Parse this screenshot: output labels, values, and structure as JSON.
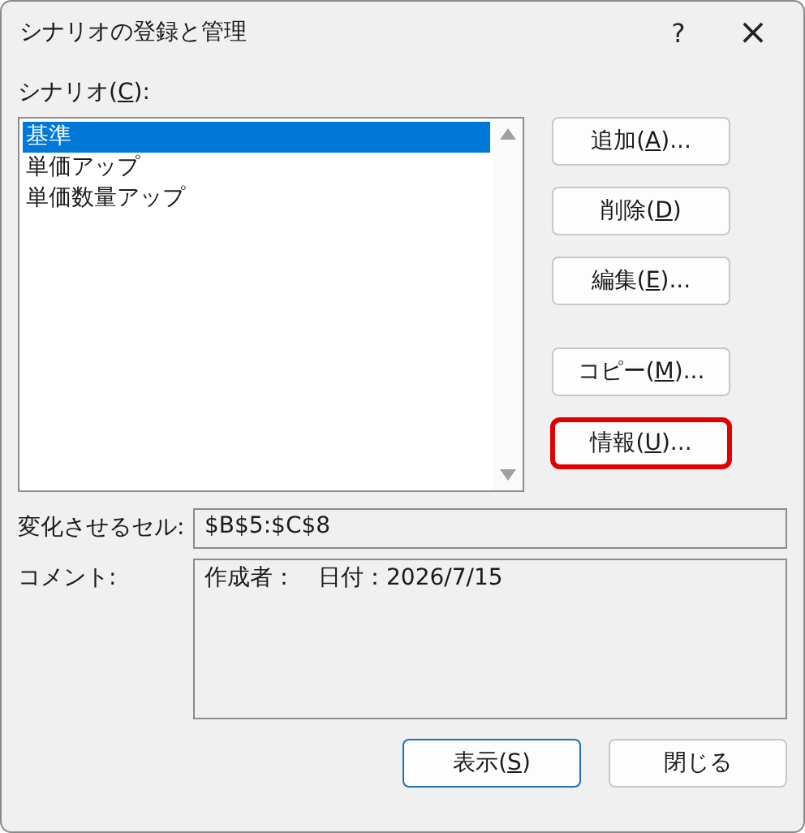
{
  "window": {
    "title": "シナリオの登録と管理",
    "help": "?",
    "close": "×"
  },
  "scenario_list": {
    "label_before": "シナリオ(",
    "access_key": "C",
    "label_after": "):",
    "items": [
      {
        "label": "基準",
        "selected": true
      },
      {
        "label": "単価アップ",
        "selected": false
      },
      {
        "label": "単価数量アップ",
        "selected": false
      }
    ]
  },
  "side_button_groups": [
    {
      "buttons": [
        {
          "label_before": "追加(",
          "access_key": "A",
          "label_after": ")...",
          "highlighted": false
        },
        {
          "label_before": "削除(",
          "access_key": "D",
          "label_after": ")",
          "highlighted": false
        },
        {
          "label_before": "編集(",
          "access_key": "E",
          "label_after": ")...",
          "highlighted": false
        }
      ]
    },
    {
      "buttons": [
        {
          "label_before": "コピー(",
          "access_key": "M",
          "label_after": ")...",
          "highlighted": false
        },
        {
          "label_before": "情報(",
          "access_key": "U",
          "label_after": ")...",
          "highlighted": true
        }
      ]
    }
  ],
  "changing_cells": {
    "label": "変化させるセル:",
    "value": "$B$5:$C$8"
  },
  "comment": {
    "label": "コメント:",
    "value": "作成者：　日付：2026/7/15"
  },
  "bottom_buttons": [
    {
      "label_before": "表示(",
      "access_key": "S",
      "label_after": ")",
      "default": true
    },
    {
      "label_before": "閉じる",
      "default": false
    }
  ]
}
